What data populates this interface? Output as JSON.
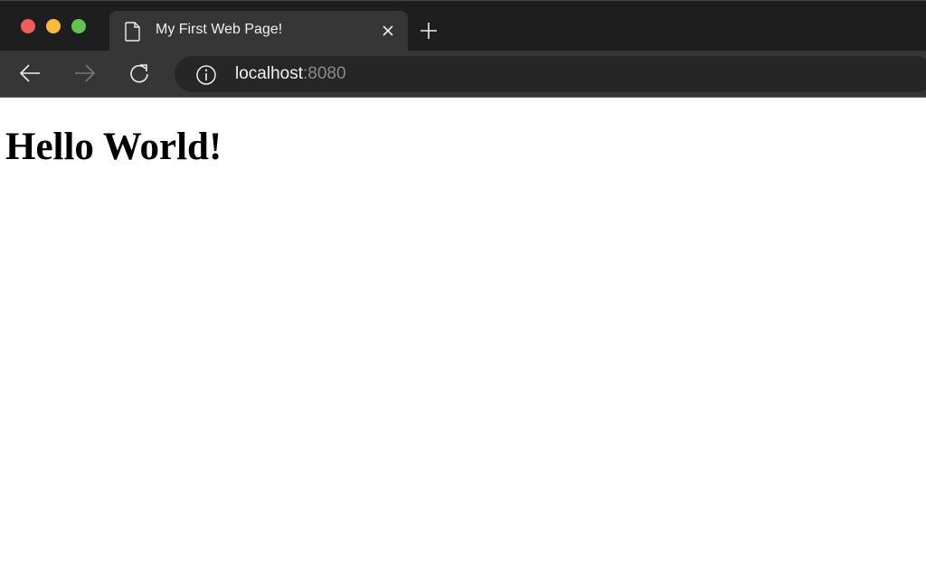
{
  "window": {
    "controls": {
      "close_color": "#ec5f57",
      "minimize_color": "#f4bd3f",
      "maximize_color": "#5fc454"
    }
  },
  "tabs": [
    {
      "title": "My First Web Page!",
      "icon": "document-icon",
      "active": true
    }
  ],
  "toolbar": {
    "back_icon": "arrow-left-icon",
    "forward_icon": "arrow-right-icon",
    "reload_icon": "reload-icon"
  },
  "address_bar": {
    "host": "localhost",
    "port": ":8080",
    "icon": "info-icon"
  },
  "page": {
    "heading": "Hello World!"
  }
}
